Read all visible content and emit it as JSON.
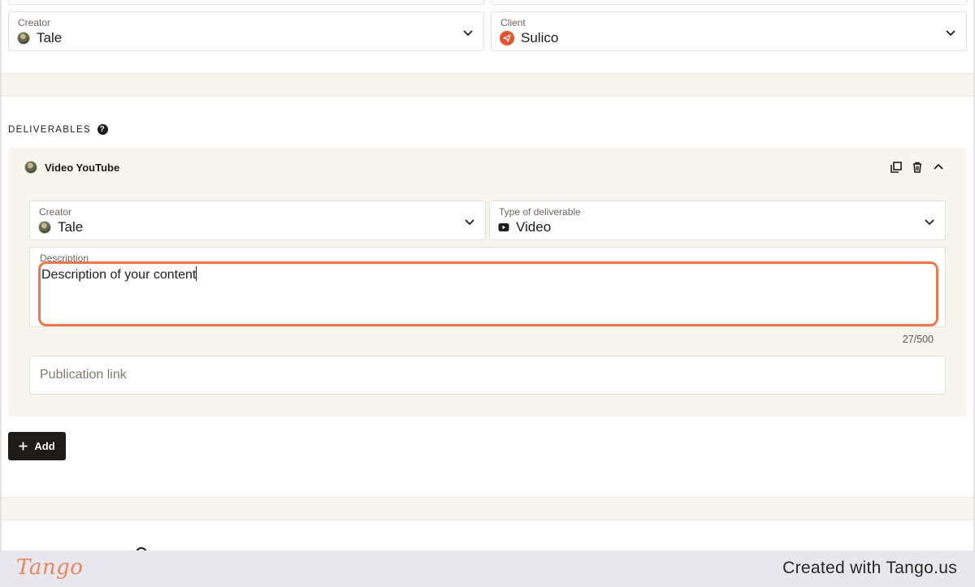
{
  "top_fields": {
    "creator": {
      "label": "Creator",
      "value": "Tale"
    },
    "client": {
      "label": "Client",
      "value": "Sulico"
    }
  },
  "deliverables": {
    "section_title": "DELIVERABLES",
    "help_symbol": "?",
    "card": {
      "title": "Video YouTube",
      "creator": {
        "label": "Creator",
        "value": "Tale"
      },
      "type": {
        "label": "Type of deliverable",
        "value": "Video"
      },
      "description": {
        "label": "Description",
        "value": "Description of your content"
      },
      "counter": "27/500",
      "publication_link": {
        "placeholder": "Publication link",
        "value": ""
      }
    },
    "add_button_label": "Add"
  },
  "footer": {
    "logo_text": "Tango",
    "created_text": "Created with Tango.us"
  },
  "colors": {
    "accent_focus": "#e9784a",
    "card_bg": "#f8f4ee",
    "button_bg": "#1f1b18",
    "client_logo": "#e8532f",
    "footer_logo": "#e9865f"
  },
  "icons": {
    "creator_avatar": "avatar",
    "client_logo": "paper-plane-icon",
    "video_type": "youtube-play-icon",
    "duplicate": "duplicate-icon",
    "delete": "trash-icon",
    "collapse": "chevron-up-icon",
    "dropdown": "chevron-down-icon",
    "add": "plus-icon",
    "help": "help-icon"
  }
}
